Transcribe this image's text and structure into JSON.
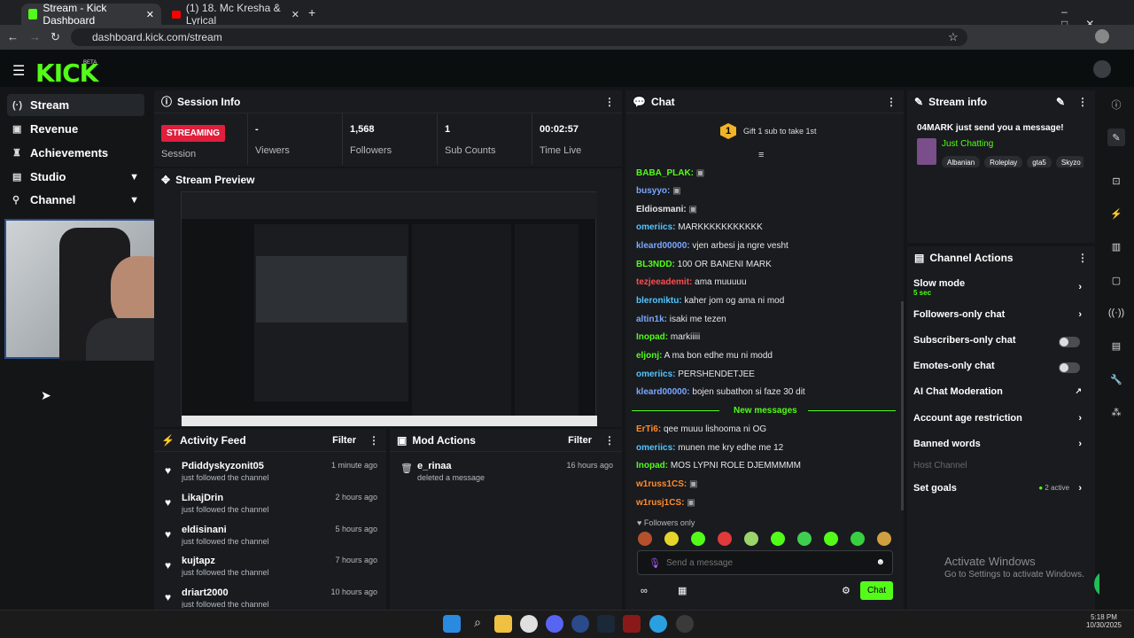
{
  "browser": {
    "tabs": [
      {
        "title": "Stream - Kick Dashboard"
      },
      {
        "title": "(1) 18. Mc Kresha & Lyrical"
      }
    ],
    "url": "dashboard.kick.com/stream",
    "add_tab": "+"
  },
  "app": {
    "logo": "KICK",
    "logo_badge": "BETA"
  },
  "sidebar": {
    "items": [
      {
        "label": "Stream",
        "icon": "stream-icon"
      },
      {
        "label": "Revenue",
        "icon": "revenue-icon"
      },
      {
        "label": "Achievements",
        "icon": "trophy-icon"
      },
      {
        "label": "Studio",
        "icon": "studio-icon",
        "expandable": true
      },
      {
        "label": "Channel",
        "icon": "channel-icon",
        "expandable": true
      }
    ]
  },
  "session": {
    "title": "Session Info",
    "status": "STREAMING",
    "status_label": "Session",
    "stats": [
      {
        "value": "-",
        "label": "Viewers"
      },
      {
        "value": "1,568",
        "label": "Followers"
      },
      {
        "value": "1",
        "label": "Sub Counts"
      },
      {
        "value": "00:02:57",
        "label": "Time Live"
      }
    ]
  },
  "preview": {
    "title": "Stream Preview"
  },
  "activity": {
    "title": "Activity Feed",
    "filter": "Filter",
    "items": [
      {
        "name": "Pdiddyskyzonit05",
        "action": "just followed the channel",
        "time": "1 minute ago"
      },
      {
        "name": "LikajDrin",
        "action": "just followed the channel",
        "time": "2 hours ago"
      },
      {
        "name": "eldisinani",
        "action": "just followed the channel",
        "time": "5 hours ago"
      },
      {
        "name": "kujtapz",
        "action": "just followed the channel",
        "time": "7 hours ago"
      },
      {
        "name": "driart2000",
        "action": "just followed the channel",
        "time": "10 hours ago"
      }
    ]
  },
  "mod": {
    "title": "Mod Actions",
    "filter": "Filter",
    "items": [
      {
        "name": "e_rinaa",
        "action": "deleted a message",
        "time": "16 hours ago"
      }
    ]
  },
  "chat": {
    "title": "Chat",
    "gift_rank": "1",
    "gift_text": "Gift 1 sub to take 1st",
    "messages": [
      {
        "user": "BABA_PLAK:",
        "text": "",
        "color": "#53fc18"
      },
      {
        "user": "busyyo:",
        "text": "",
        "color": "#7aa7ff"
      },
      {
        "user": "Eldiosmani:",
        "text": "",
        "color": "#e6e6e6"
      },
      {
        "user": "omeriics:",
        "text": "MARKKKKKKKKKKK",
        "color": "#53c6ff"
      },
      {
        "user": "kleard00000:",
        "text": "vjen arbesi ja ngre vesht",
        "color": "#7aa7ff"
      },
      {
        "user": "BL3NDD:",
        "text": "100 OR BANENI MARK",
        "color": "#53fc18"
      },
      {
        "user": "tezjeeademit:",
        "text": "ama muuuuu",
        "color": "#ff4d4d"
      },
      {
        "user": "bleroniktu:",
        "text": "kaher jom og ama ni mod",
        "color": "#53c6ff"
      },
      {
        "user": "altin1k:",
        "text": "isaki me tezen",
        "color": "#7aa7ff"
      },
      {
        "user": "Inopad:",
        "text": "markiiiii",
        "color": "#53fc18"
      },
      {
        "user": "eljonj:",
        "text": "A ma bon edhe mu ni modd",
        "color": "#53fc18"
      },
      {
        "user": "omeriics:",
        "text": "PERSHENDETJEE",
        "color": "#53c6ff"
      },
      {
        "user": "kleard00000:",
        "text": "bojen subathon si faze 30 dit",
        "color": "#7aa7ff"
      }
    ],
    "new_messages": "New messages",
    "messages2": [
      {
        "user": "ErTi6:",
        "text": "qee muuu lishooma ni OG",
        "color": "#ff8c2e"
      },
      {
        "user": "omeriics:",
        "text": "munen me kry edhe me 12",
        "color": "#53c6ff"
      },
      {
        "user": "Inopad:",
        "text": "MOS LYPNI ROLE DJEMMMMM",
        "color": "#53fc18"
      },
      {
        "user": "w1russ1CS:",
        "text": "",
        "color": "#ff8c2e"
      },
      {
        "user": "w1rusj1CS:",
        "text": "",
        "color": "#ff8c2e"
      }
    ],
    "followers_only": "Followers only",
    "placeholder": "Send a message",
    "send": "Chat"
  },
  "streaminfo": {
    "title": "Stream info",
    "message": "04MARK just send you a message!",
    "category": "Just Chatting",
    "tags": [
      "Albanian",
      "Roleplay",
      "gta5",
      "Skyzo"
    ]
  },
  "actions": {
    "title": "Channel Actions",
    "slow_mode": "Slow mode",
    "slow_value": "5 sec",
    "followers_only": "Followers-only chat",
    "subscribers_only": "Subscribers-only chat",
    "emotes_only": "Emotes-only chat",
    "ai_mod": "AI Chat Moderation",
    "account_age": "Account age restriction",
    "banned": "Banned words",
    "host": "Host Channel",
    "goals": "Set goals",
    "goals_status": "2 active"
  },
  "watermark": {
    "line1": "Activate Windows",
    "line2": "Go to Settings to activate Windows."
  },
  "taskbar": {
    "time": "5:18 PM",
    "date": "10/30/2025"
  }
}
